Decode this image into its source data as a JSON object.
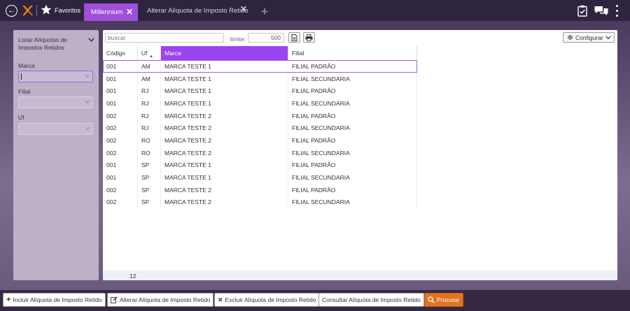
{
  "topbar": {
    "favorites_label": "Favoritos",
    "tabs": [
      {
        "label": "Millennium",
        "active": true
      },
      {
        "label": "Alterar Alíquota de Imposto Retido",
        "active": false
      }
    ],
    "add_tab_glyph": "+",
    "close_glyph": "✕",
    "back_glyph": "←"
  },
  "sidebar": {
    "title": "Listar Alíquotas de Impostos Retidos",
    "fields": [
      {
        "label": "Marca",
        "value": ""
      },
      {
        "label": "Filial",
        "value": ""
      },
      {
        "label": "Uf",
        "value": ""
      }
    ]
  },
  "toolbar": {
    "search_placeholder": "buscar",
    "limit_label": "limite:",
    "limit_value": "500",
    "configure_label": "Configurar"
  },
  "table": {
    "columns": [
      "Código",
      "Uf",
      "Marca",
      "Filial"
    ],
    "rows": [
      [
        "001",
        "AM",
        "MARCA TESTE 1",
        "FILIAL PADRÃO"
      ],
      [
        "001",
        "AM",
        "MARCA TESTE 1",
        "FILIAL SECUNDARIA"
      ],
      [
        "001",
        "RJ",
        "MARCA TESTE 1",
        "FILIAL PADRÃO"
      ],
      [
        "001",
        "RJ",
        "MARCA TESTE 1",
        "FILIAL SECUNDARIA"
      ],
      [
        "002",
        "RJ",
        "MARCA TESTE 2",
        "FILIAL PADRÃO"
      ],
      [
        "002",
        "RJ",
        "MARCA TESTE 2",
        "FILIAL SECUNDARIA"
      ],
      [
        "002",
        "RO",
        "MARCA TESTE 2",
        "FILIAL PADRÃO"
      ],
      [
        "002",
        "RO",
        "MARCA TESTE 2",
        "FILIAL SECUNDARIA"
      ],
      [
        "001",
        "SP",
        "MARCA TESTE 1",
        "FILIAL PADRÃO"
      ],
      [
        "001",
        "SP",
        "MARCA TESTE 1",
        "FILIAL SECUNDARIA"
      ],
      [
        "002",
        "SP",
        "MARCA TESTE 2",
        "FILIAL PADRÃO"
      ],
      [
        "002",
        "SP",
        "MARCA TESTE 2",
        "FILIAL SECUNDARIA"
      ]
    ],
    "selected_row": 0,
    "row_count": "12"
  },
  "actions": {
    "include": "Incluir Alíquota de Imposto Retido",
    "alter": "Alterar Alíquota de Imposto Retido",
    "exclude": "Excluir Alíquota de Imposto Retido",
    "consult": "Consultar Alíquota de Imposto Retido",
    "search": "Procurar"
  },
  "colors": {
    "accent": "#9b45f0",
    "search_button": "#e2731f",
    "logo": "#f07b1c"
  }
}
